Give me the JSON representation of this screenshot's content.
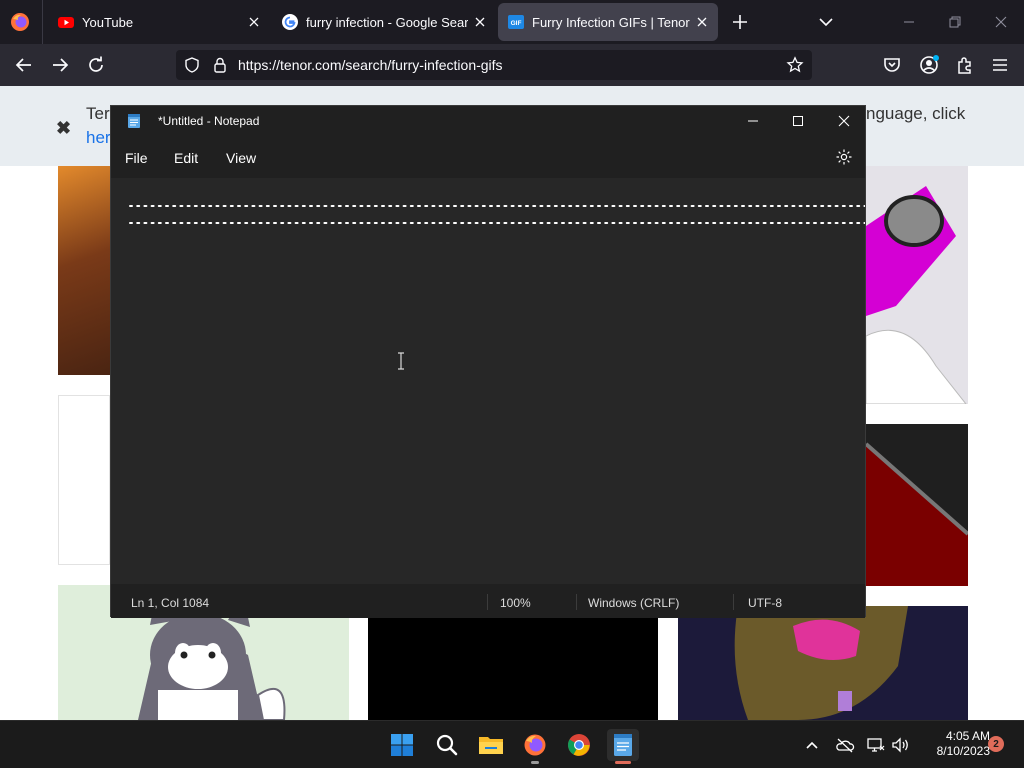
{
  "browser": {
    "tabs": [
      {
        "title": "YouTube",
        "favicon": "youtube-icon"
      },
      {
        "title": "furry infection - Google Search",
        "favicon": "google-icon"
      },
      {
        "title": "Furry Infection GIFs | Tenor",
        "favicon": "tenor-gif-icon",
        "favicon_text": "GIF",
        "active": true
      }
    ],
    "url": "https://tenor.com/search/furry-infection-gifs",
    "colors": {
      "chrome_dark": "#1c1b22",
      "toolbar": "#2b2a33",
      "active_tab": "#42414d"
    }
  },
  "page": {
    "banner": {
      "text_left": "Ter",
      "text_right": "nguage, click",
      "link": "her",
      "close_symbol": "✖"
    }
  },
  "notepad": {
    "title": "*Untitled - Notepad",
    "menu": [
      "File",
      "Edit",
      "View"
    ],
    "status": {
      "position": "Ln 1, Col 1084",
      "zoom": "100%",
      "line_ending": "Windows (CRLF)",
      "encoding": "UTF-8"
    },
    "colors": {
      "background": "#272727",
      "bar": "#202020"
    }
  },
  "taskbar": {
    "apps": [
      "windows-start-icon",
      "search-icon",
      "file-explorer-icon",
      "firefox-icon",
      "chrome-icon",
      "notepad-icon"
    ],
    "clock": {
      "time": "4:05 AM",
      "date": "8/10/2023"
    },
    "notification_count": "2"
  }
}
